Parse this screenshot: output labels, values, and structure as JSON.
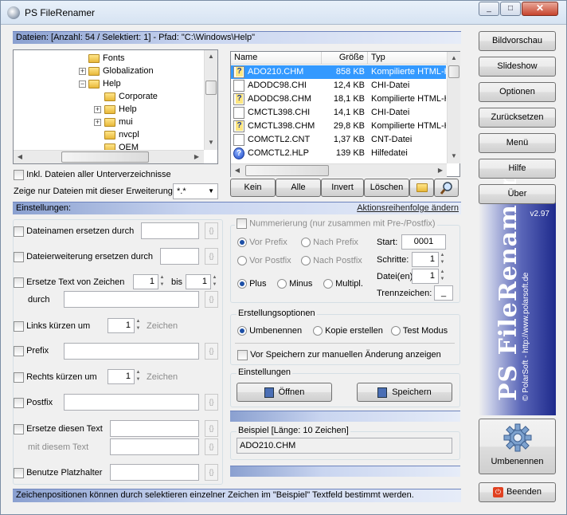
{
  "window": {
    "title": "PS FileRenamer"
  },
  "files_bar": {
    "label": "Dateien: [Anzahl: 54 / Selektiert: 1]  -  Pfad: \"C:\\Windows\\Help\""
  },
  "tree": {
    "items": [
      {
        "label": "Fonts"
      },
      {
        "label": "Globalization"
      },
      {
        "label": "Help"
      },
      {
        "label": "Corporate"
      },
      {
        "label": "Help"
      },
      {
        "label": "mui"
      },
      {
        "label": "nvcpl"
      },
      {
        "label": "OEM"
      }
    ]
  },
  "file_list": {
    "columns": [
      "Name",
      "Größe",
      "Typ"
    ],
    "rows": [
      {
        "name": "ADO210.CHM",
        "size": "858 KB",
        "type": "Kompilierte HTML-H",
        "icon": "chm-icon",
        "selected": true
      },
      {
        "name": "ADODC98.CHI",
        "size": "12,4 KB",
        "type": "CHI-Datei",
        "icon": "file-icon"
      },
      {
        "name": "ADODC98.CHM",
        "size": "18,1 KB",
        "type": "Kompilierte HTML-H",
        "icon": "chm-icon"
      },
      {
        "name": "CMCTL398.CHI",
        "size": "14,1 KB",
        "type": "CHI-Datei",
        "icon": "file-icon"
      },
      {
        "name": "CMCTL398.CHM",
        "size": "29,8 KB",
        "type": "Kompilierte HTML-H",
        "icon": "chm-icon"
      },
      {
        "name": "COMCTL2.CNT",
        "size": "1,37 KB",
        "type": "CNT-Datei",
        "icon": "file-icon"
      },
      {
        "name": "COMCTL2.HLP",
        "size": "139 KB",
        "type": "Hilfedatei",
        "icon": "help-icon"
      }
    ]
  },
  "file_buttons": {
    "none": "Kein",
    "all": "Alle",
    "invert": "Invert",
    "delete": "Löschen"
  },
  "include_sub": {
    "label": "Inkl. Dateien aller Unterverzeichnisse"
  },
  "ext_filter": {
    "label": "Zeige nur Dateien mit dieser Erweiterung:",
    "value": "*.*"
  },
  "settings_bar": {
    "label": "Einstellungen:",
    "link": "Aktionsreihenfolge ändern"
  },
  "left_options": {
    "replace_names": "Dateinamen ersetzen durch",
    "replace_ext": "Dateierweiterung ersetzen durch",
    "replace_from": "Ersetze Text von Zeichen",
    "from_value": "1",
    "to_label": "bis",
    "to_value": "1",
    "by_label": "durch",
    "trim_left": "Links kürzen um",
    "trim_left_value": "1",
    "chars_label": "Zeichen",
    "prefix": "Prefix",
    "trim_right": "Rechts kürzen um",
    "trim_right_value": "1",
    "chars_label2": "Zeichen",
    "postfix": "Postfix",
    "replace_text": "Ersetze diesen Text",
    "with_text": "mit diesem Text",
    "placeholder": "Benutze Platzhalter",
    "dots": "{}"
  },
  "numbering": {
    "label": "Nummerierung (nur zusammen mit Pre-/Postfix)",
    "vor_prefix": "Vor Prefix",
    "nach_prefix": "Nach Prefix",
    "vor_postfix": "Vor Postfix",
    "nach_postfix": "Nach Postfix",
    "plus": "Plus",
    "minus": "Minus",
    "multipl": "Multipl.",
    "start_label": "Start:",
    "start_value": "0001",
    "steps_label": "Schritte:",
    "steps_value": "1",
    "files_label": "Datei(en):",
    "files_value": "1",
    "sep_label": "Trennzeichen:",
    "sep_value": "_"
  },
  "create_options": {
    "title": "Erstellungsoptionen",
    "rename": "Umbenennen",
    "copy": "Kopie erstellen",
    "test": "Test Modus",
    "before_save": "Vor Speichern zur manuellen Änderung anzeigen"
  },
  "settings_group": {
    "title": "Einstellungen",
    "open": "Öffnen",
    "save": "Speichern"
  },
  "example": {
    "label": "Beispiel  [Länge: 10 Zeichen]",
    "value": "ADO210.CHM"
  },
  "sidebar": {
    "buttons": [
      "Bildvorschau",
      "Slideshow",
      "Optionen",
      "Zurücksetzen",
      "Menü",
      "Hilfe",
      "Über"
    ],
    "version": "v2.97",
    "brand": "PS FileRenamer",
    "credit": "© PolarSoft - http://www.polarsoft.de",
    "rename_button": "Umbenennen",
    "exit_button": "Beenden"
  },
  "status": {
    "text": "Zeichenpositionen können durch selektieren einzelner Zeichen im \"Beispiel\" Textfeld bestimmt werden."
  },
  "colors": {
    "accent": "#3399ff",
    "bar": "#8aa0d0",
    "brand_bg": "#1e2a8c"
  }
}
